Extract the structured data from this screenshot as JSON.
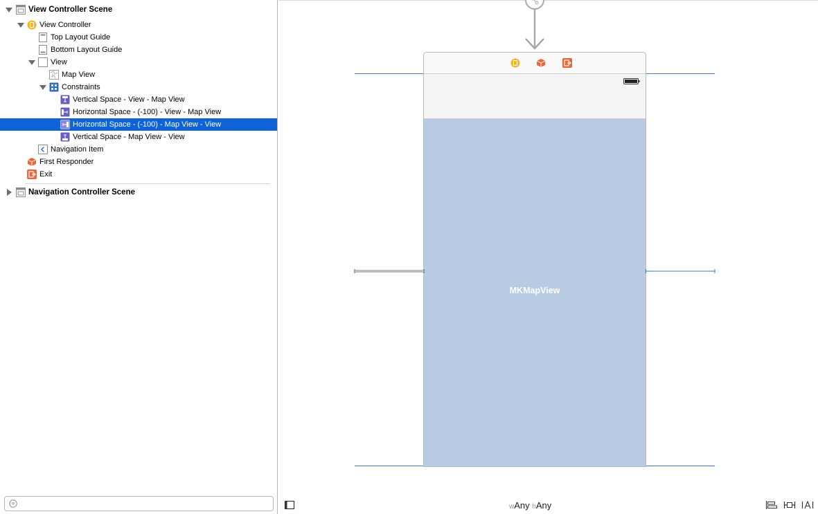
{
  "outline": {
    "rows": [
      {
        "label": "View Controller Scene",
        "bold": true
      },
      {
        "label": "View Controller"
      },
      {
        "label": "Top Layout Guide"
      },
      {
        "label": "Bottom Layout Guide"
      },
      {
        "label": "View"
      },
      {
        "label": "Map View"
      },
      {
        "label": "Constraints"
      },
      {
        "label": "Vertical Space - View - Map View"
      },
      {
        "label": "Horizontal Space - (-100) - View - Map View"
      },
      {
        "label": "Horizontal Space - (-100) - Map View - View",
        "selected": true
      },
      {
        "label": "Vertical Space - Map View - View"
      },
      {
        "label": "Navigation Item"
      },
      {
        "label": "First Responder"
      },
      {
        "label": "Exit"
      },
      {
        "label": "Navigation Controller Scene",
        "bold": true
      }
    ],
    "filter_placeholder": ""
  },
  "canvas": {
    "map_view_label": "MKMapView",
    "dock_icons": [
      "view-controller-icon",
      "first-responder-icon",
      "exit-icon"
    ]
  },
  "bottom_bar": {
    "w_prefix": "w",
    "w_value": "Any",
    "h_prefix": "h",
    "h_value": "Any",
    "icons": [
      "document-outline-toggle-icon",
      "align-icon",
      "pin-icon",
      "resolve-icon"
    ]
  },
  "colors": {
    "selection": "#0f63d6",
    "map_view_fill": "#b8cbe2",
    "guide_line": "#3a79b8",
    "vc_icon": "#f2b51c",
    "exit_icon": "#e8673c",
    "constraint_icon": "#6a5fc1"
  }
}
